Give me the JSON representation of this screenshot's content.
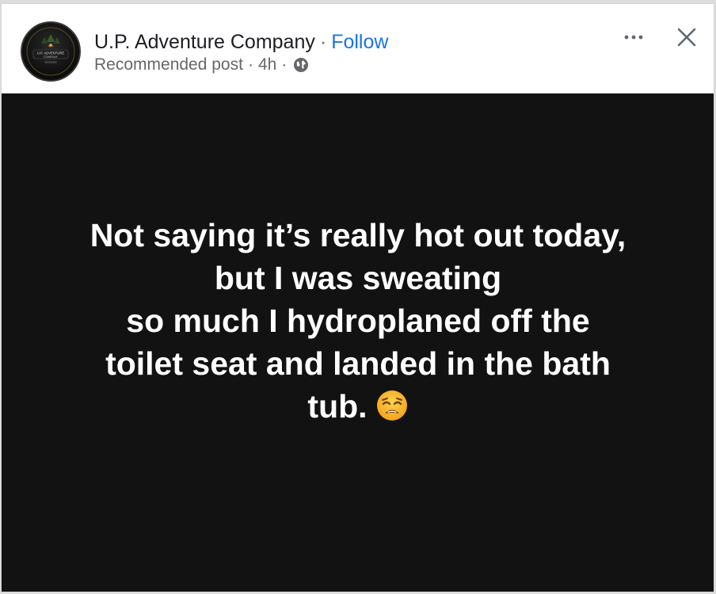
{
  "post": {
    "author": "U.P. Adventure Company",
    "separator": "·",
    "follow_label": "Follow",
    "subtitle": "Recommended post",
    "time": "4h",
    "meta_separator": "·",
    "visibility_icon": "globe-icon",
    "avatar_text_line1": "U.P. ADVENTURE",
    "avatar_text_line2": "COMPANY",
    "more_icon": "more-options-icon",
    "close_icon": "close-icon",
    "body_background": "#121212",
    "body_lines": [
      "Not saying it’s really hot out today,",
      "but I was sweating",
      "so much I hydroplaned off the",
      "toilet seat and landed in the bath",
      "tub."
    ],
    "emoji": "weary-face-emoji"
  },
  "colors": {
    "follow": "#1b74e4",
    "text_primary": "#1c1e21",
    "text_secondary": "#65676b",
    "post_text": "#ffffff"
  }
}
